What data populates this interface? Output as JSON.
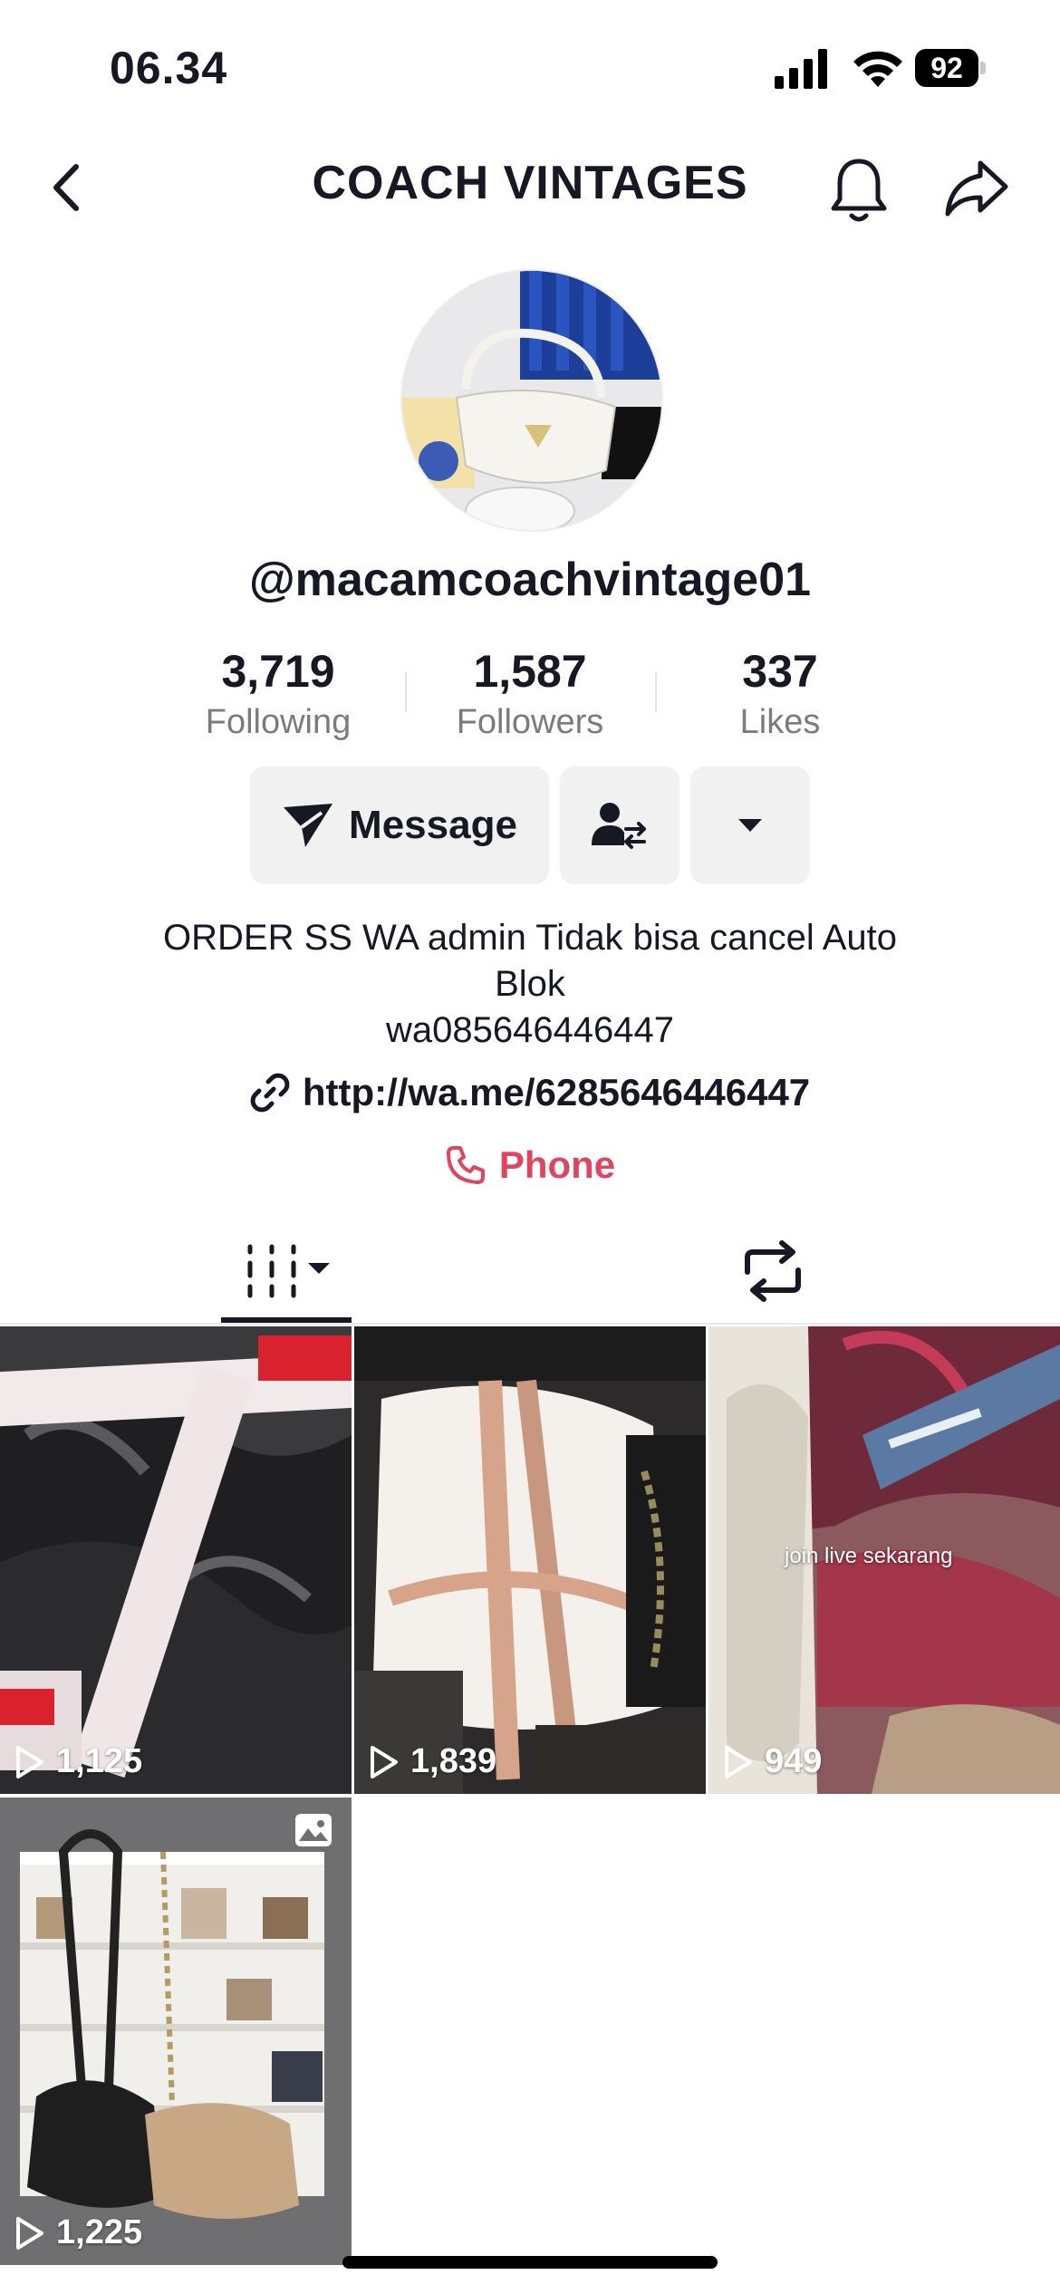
{
  "status_bar": {
    "time": "06.34",
    "battery": "92"
  },
  "nav": {
    "title": "COACH VINTAGES"
  },
  "profile": {
    "username": "@macamcoachvintage01",
    "stats": [
      {
        "value": "3,719",
        "label": "Following"
      },
      {
        "value": "1,587",
        "label": "Followers"
      },
      {
        "value": "337",
        "label": "Likes"
      }
    ],
    "message_label": "Message",
    "bio_line1": "ORDER SS WA admin Tidak bisa cancel Auto",
    "bio_line2": "Blok",
    "bio_line3": "wa085646446447",
    "link": "http://wa.me/6285646446447",
    "phone_label": "Phone"
  },
  "videos": [
    {
      "views": "1,125"
    },
    {
      "views": "1,839"
    },
    {
      "views": "949",
      "overlay": "join live sekarang"
    },
    {
      "views": "1,225"
    }
  ],
  "colors": {
    "accent_red": "#e0455f",
    "text": "#161823",
    "muted": "#7a7b80",
    "button_bg": "#f1f1f2"
  }
}
